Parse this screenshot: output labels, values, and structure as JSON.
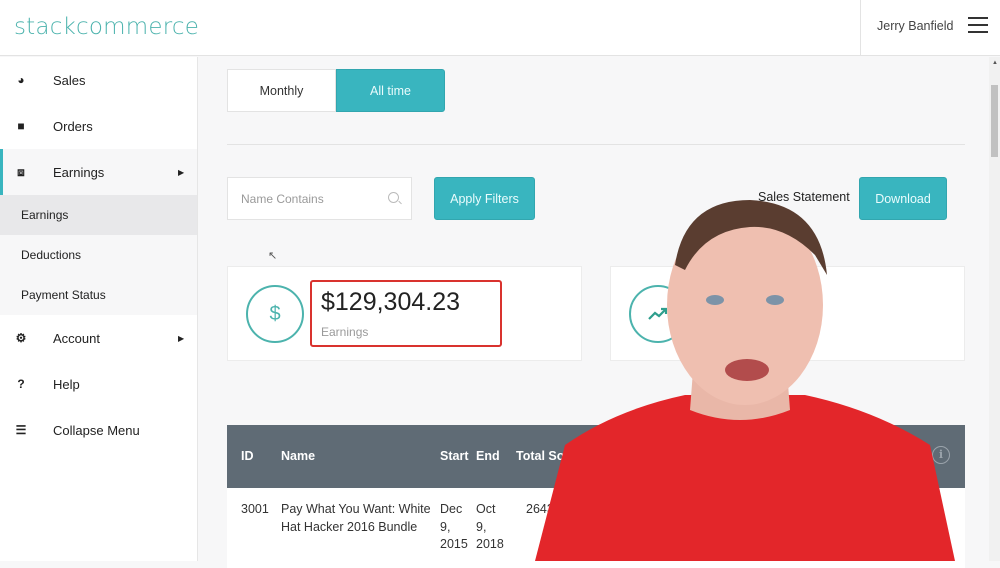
{
  "header": {
    "logo": "stackcommerce",
    "user_name": "Jerry Banfield",
    "menu_icon": "hamburger-icon"
  },
  "sidebar": {
    "items": [
      {
        "label": "Sales",
        "icon": "tachometer-icon",
        "glyph": "◕"
      },
      {
        "label": "Orders",
        "icon": "book-icon",
        "glyph": "■"
      },
      {
        "label": "Earnings",
        "icon": "money-icon",
        "glyph": "⧈",
        "caret": "▶"
      },
      {
        "label": "Account",
        "icon": "gear-icon",
        "glyph": "⚙",
        "caret": "▶"
      },
      {
        "label": "Help",
        "icon": "question-icon",
        "glyph": "?"
      },
      {
        "label": "Collapse Menu",
        "icon": "list-icon",
        "glyph": "☰"
      }
    ],
    "sub_items": [
      {
        "label": "Earnings",
        "selected": true
      },
      {
        "label": "Deductions"
      },
      {
        "label": "Payment Status"
      }
    ]
  },
  "main": {
    "period_tabs": [
      {
        "label": "Monthly",
        "active": false
      },
      {
        "label": "All time",
        "active": true
      }
    ],
    "filter": {
      "placeholder": "Name Contains",
      "value": "",
      "apply_label": "Apply Filters"
    },
    "sales_statement": {
      "label": "Sales Statement",
      "download_label": "Download"
    },
    "earnings_card": {
      "icon_glyph": "$",
      "amount": "$129,304.23",
      "label": "Earnings"
    },
    "trend_card": {
      "icon": "trend-up-icon"
    },
    "table": {
      "columns": [
        "ID",
        "Name",
        "Start",
        "End",
        "Total Sold"
      ],
      "info_glyph": "i",
      "rows": [
        {
          "id": "3001",
          "name": "Pay What You Want: White Hat Hacker 2016 Bundle",
          "start": "Dec 9, 2015",
          "end": "Oct 9, 2018",
          "total_sold": "2643"
        }
      ]
    }
  },
  "colors": {
    "accent": "#39b5bf",
    "logo": "#4cb3ad",
    "highlight": "#d9322e",
    "table_header": "#5f6b75"
  }
}
